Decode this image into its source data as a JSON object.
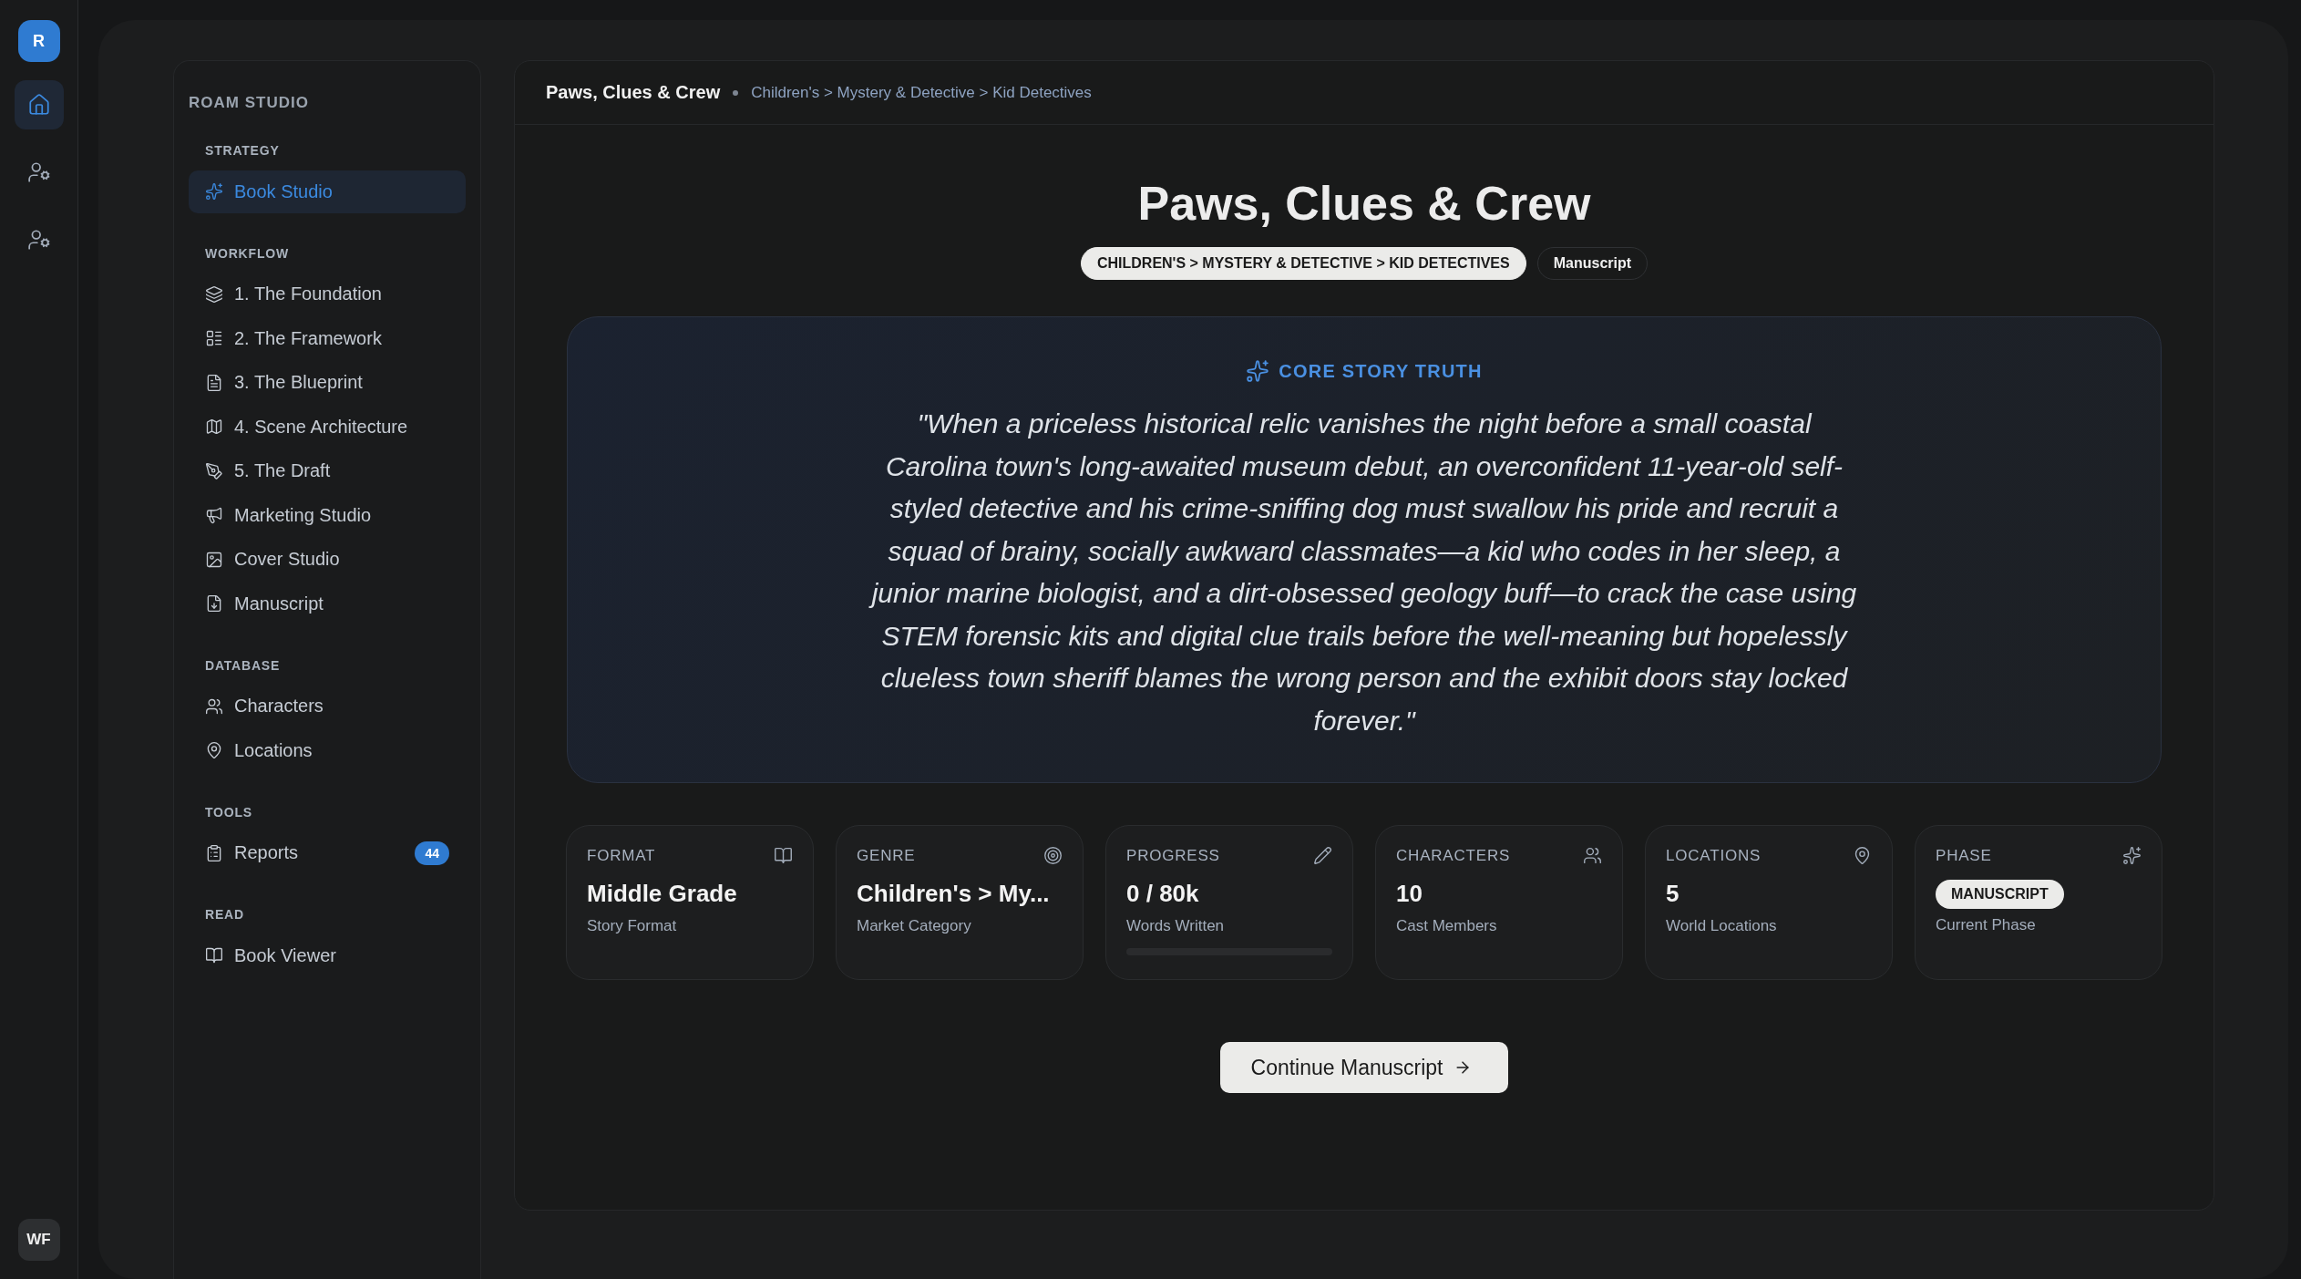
{
  "rail": {
    "avatar": "R",
    "items": [
      {
        "selected": true
      },
      {
        "selected": false
      },
      {
        "selected": false
      }
    ],
    "user": "WF"
  },
  "sidebar": {
    "brand": "ROAM STUDIO",
    "sections": [
      {
        "title": "STRATEGY",
        "items": [
          {
            "label": "Book Studio",
            "selected": true
          }
        ]
      },
      {
        "title": "WORKFLOW",
        "items": [
          {
            "label": "1. The Foundation",
            "selected": false
          },
          {
            "label": "2. The Framework",
            "selected": false
          },
          {
            "label": "3. The Blueprint",
            "selected": false
          },
          {
            "label": "4. Scene Architecture",
            "selected": false
          },
          {
            "label": "5. The Draft",
            "selected": false
          },
          {
            "label": "Marketing Studio",
            "selected": false
          },
          {
            "label": "Cover Studio",
            "selected": false
          },
          {
            "label": "Manuscript",
            "selected": false
          }
        ]
      },
      {
        "title": "DATABASE",
        "items": [
          {
            "label": "Characters",
            "selected": false
          },
          {
            "label": "Locations",
            "selected": false
          }
        ]
      },
      {
        "title": "TOOLS",
        "items": [
          {
            "label": "Reports",
            "selected": false,
            "badge": "44"
          }
        ]
      },
      {
        "title": "READ",
        "items": [
          {
            "label": "Book Viewer",
            "selected": false
          }
        ]
      }
    ]
  },
  "breadcrumb": {
    "title": "Paws, Clues & Crew",
    "path": "Children's > Mystery & Detective > Kid Detectives"
  },
  "hero": {
    "title": "Paws, Clues & Crew",
    "tags": [
      {
        "label": "CHILDREN'S > MYSTERY & DETECTIVE > KID DETECTIVES",
        "kind": "filled"
      },
      {
        "label": "Manuscript",
        "kind": "outline"
      }
    ]
  },
  "core_truth": {
    "label": "CORE STORY TRUTH",
    "quote": "\"When a priceless historical relic vanishes the night before a small coastal Carolina town's long-awaited museum debut, an overconfident 11-year-old self-styled detective and his crime-sniffing dog must swallow his pride and recruit a squad of brainy, socially awkward classmates—a kid who codes in her sleep, a junior marine biologist, and a dirt-obsessed geology buff—to crack the case using STEM forensic kits and digital clue trails before the well-meaning but hopelessly clueless town sheriff blames the wrong person and the exhibit doors stay locked forever.\""
  },
  "cards": [
    {
      "kind": "text",
      "label": "FORMAT",
      "value": "Middle Grade",
      "caption": "Story Format"
    },
    {
      "kind": "text",
      "label": "GENRE",
      "value": "Children's > My...",
      "caption": "Market Category"
    },
    {
      "kind": "progress",
      "label": "PROGRESS",
      "value": "0 / 80k",
      "caption": "Words Written",
      "level": 0
    },
    {
      "kind": "text",
      "label": "CHARACTERS",
      "value": "10",
      "caption": "Cast Members"
    },
    {
      "kind": "text",
      "label": "LOCATIONS",
      "value": "5",
      "caption": "World Locations"
    },
    {
      "kind": "badge",
      "label": "PHASE",
      "value": "MANUSCRIPT",
      "caption": "Current Phase"
    }
  ],
  "button": {
    "label": "Continue Manuscript"
  }
}
